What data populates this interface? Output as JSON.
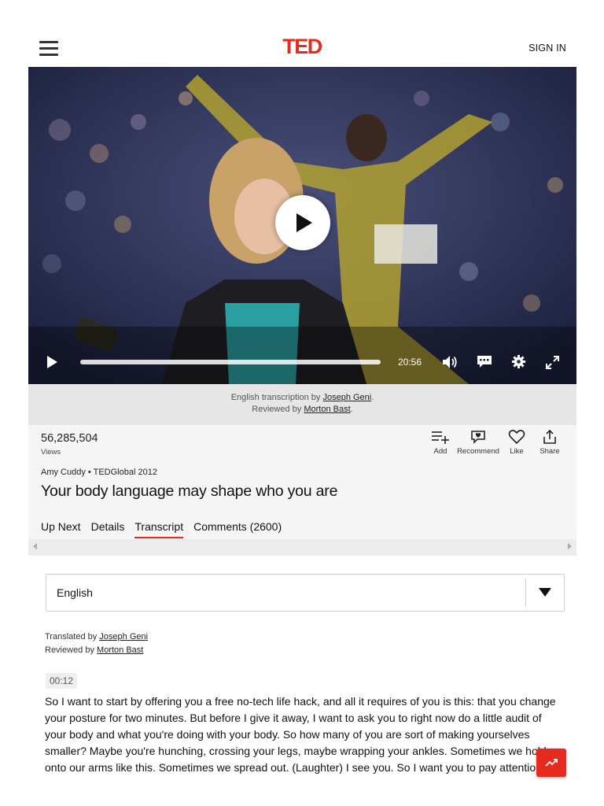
{
  "header": {
    "logo": "TED",
    "signin_label": "SIGN IN"
  },
  "player": {
    "duration": "20:56",
    "progress": 0
  },
  "credits_strip": {
    "transcription_prefix": "English transcription by ",
    "transcriber": "Joseph Geni",
    "reviewed_prefix": "Reviewed by ",
    "reviewer": "Morton Bast"
  },
  "talk": {
    "views_count": "56,285,504",
    "views_label": "Views",
    "speaker_event": "Amy Cuddy • TEDGlobal 2012",
    "title": "Your body language may shape who you are"
  },
  "actions": [
    {
      "label": "Add",
      "icon": "add-to-list-icon"
    },
    {
      "label": "Recommend",
      "icon": "recommend-icon"
    },
    {
      "label": "Like",
      "icon": "heart-icon"
    },
    {
      "label": "Share",
      "icon": "share-icon"
    }
  ],
  "tabs": [
    {
      "label": "Up Next"
    },
    {
      "label": "Details"
    },
    {
      "label": "Transcript",
      "active": true
    },
    {
      "label": "Comments (2600)"
    }
  ],
  "transcript": {
    "language": "English",
    "translated_prefix": "Translated by ",
    "translator": "Joseph Geni",
    "reviewed_prefix": "Reviewed by ",
    "reviewer": "Morton Bast",
    "timestamp": "00:12",
    "paragraph": "So I want to start by offering you a free no-tech life hack, and all it requires of you is this: that you change your posture for two minutes. But before I give it away, I want to ask you to right now do a little audit of your body and what you're doing with your body. So how many of you are sort of making yourselves smaller? Maybe you're hunching, crossing your legs, maybe wrapping your ankles. Sometimes we hold onto our arms like this. Sometimes we spread out. (Laughter) I see you. So I want you to pay attention to"
  },
  "colors": {
    "brand": "#e62b1e"
  }
}
